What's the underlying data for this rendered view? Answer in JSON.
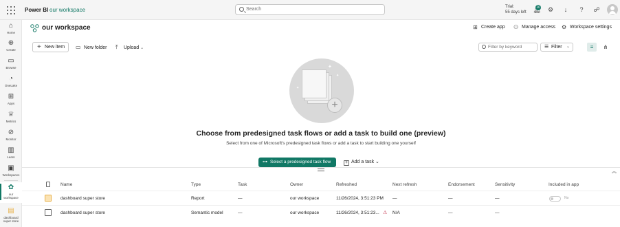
{
  "app": {
    "brand": "Power BI",
    "breadcrumb": "our workspace"
  },
  "search": {
    "placeholder": "Search"
  },
  "trial": {
    "line1": "Trial:",
    "line2": "55 days left"
  },
  "notifications": {
    "count": "10"
  },
  "leftnav": {
    "items": [
      {
        "label": "Home",
        "icon": "home-icon"
      },
      {
        "label": "Create",
        "icon": "plus-circle-icon"
      },
      {
        "label": "Browse",
        "icon": "folder-icon"
      },
      {
        "label": "OneLake",
        "icon": "onelake-icon"
      },
      {
        "label": "Apps",
        "icon": "apps-icon"
      },
      {
        "label": "Metrics",
        "icon": "trophy-icon"
      },
      {
        "label": "Monitor",
        "icon": "monitor-icon"
      },
      {
        "label": "Learn",
        "icon": "book-icon"
      },
      {
        "label": "Workspaces",
        "icon": "workspaces-icon"
      },
      {
        "label_line1": "our",
        "label_line2": "workspace",
        "icon": "workspace-icon",
        "active": true
      },
      {
        "label_line1": "dashboard",
        "label_line2": "super store",
        "icon": "report-icon"
      }
    ]
  },
  "workspace": {
    "title": "our workspace",
    "actions": {
      "create_app": "Create app",
      "manage_access": "Manage access",
      "settings": "Workspace settings"
    }
  },
  "toolbar": {
    "new_item": "New item",
    "new_folder": "New folder",
    "upload": "Upload",
    "filter_placeholder": "Filter by keyword",
    "filter": "Filter"
  },
  "empty_state": {
    "title": "Choose from predesigned task flows or add a task to build one (preview)",
    "subtitle": "Select from one of Microsoft's predesigned task flows or add a task to start building one yourself",
    "primary_button": "Select a predesigned task flow",
    "secondary_button": "Add a task"
  },
  "table": {
    "columns": [
      "Name",
      "Type",
      "Task",
      "Owner",
      "Refreshed",
      "Next refresh",
      "Endorsement",
      "Sensitivity",
      "Included in app"
    ],
    "rows": [
      {
        "name": "dashboard super store",
        "type": "Report",
        "task": "—",
        "owner": "our workspace",
        "refreshed": "11/26/2024, 3:51:23 PM",
        "next_refresh": "—",
        "endorsement": "—",
        "sensitivity": "—",
        "included": "No",
        "icon_color": "#e8b14a"
      },
      {
        "name": "dashboard super store",
        "type": "Semantic model",
        "task": "—",
        "owner": "our workspace",
        "refreshed": "11/26/2024, 3:51:23...",
        "next_refresh": "N/A",
        "endorsement": "—",
        "sensitivity": "—",
        "included": "",
        "icon_color": "#616161"
      }
    ]
  },
  "colors": {
    "accent": "#117865",
    "warning": "#c4314b"
  }
}
